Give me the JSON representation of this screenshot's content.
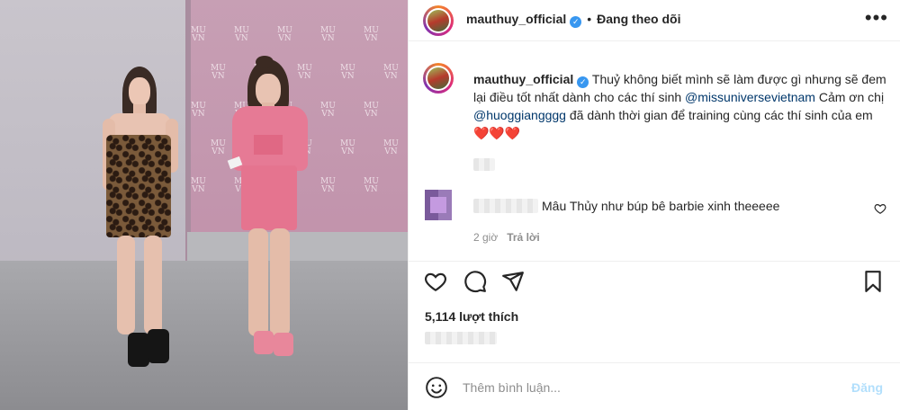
{
  "post": {
    "account": {
      "username": "mauthuy_official",
      "follow_state": "Đang theo dõi",
      "separator": "•"
    },
    "caption": {
      "username": "mauthuy_official",
      "text_part1": "Thuỷ không biết mình sẽ làm được gì nhưng sẽ đem lại điều tốt nhất dành cho các thí sinh ",
      "mention1": "@missuniversevietnam",
      "text_part2": " Cảm ơn chị ",
      "mention2": "@huoggiangggg",
      "text_part3": " đã dành thời gian để training cùng các thí sinh của em ",
      "emoji": "❤️❤️❤️"
    },
    "comment": {
      "text": "Mâu Thủy như búp bê barbie xinh theeeee",
      "time": "2 giờ",
      "reply_label": "Trả lời"
    },
    "likes": "5,114 lượt thích",
    "comment_box": {
      "placeholder": "Thêm bình luận...",
      "post_label": "Đăng"
    }
  },
  "photo": {
    "backdrop_logo_lines": [
      "MU",
      "VN"
    ]
  },
  "colors": {
    "mention": "#00376b",
    "verified": "#3897f0",
    "post_button_disabled": "#b2dffc",
    "muted_text": "#8e8e8e"
  },
  "icons": {
    "more": "more-horizontal-icon",
    "verified": "verified-badge-icon",
    "heart": "heart-icon",
    "comment": "comment-icon",
    "share": "share-icon",
    "save": "bookmark-icon",
    "emoji": "emoji-icon"
  }
}
